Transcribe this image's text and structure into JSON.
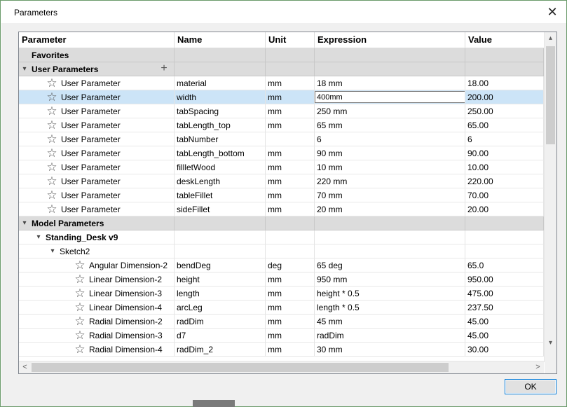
{
  "window": {
    "title": "Parameters",
    "close_glyph": "✕"
  },
  "columns": {
    "parameter": "Parameter",
    "name": "Name",
    "unit": "Unit",
    "expression": "Expression",
    "value": "Value"
  },
  "rows": [
    {
      "type": "group",
      "indent": 0,
      "expander": "",
      "label": "Favorites",
      "name": "",
      "unit": "",
      "expression": "",
      "value": ""
    },
    {
      "type": "group",
      "indent": 0,
      "expander": "▾",
      "label": "User Parameters",
      "name": "",
      "unit": "",
      "expression": "",
      "value": "",
      "add_button": "+"
    },
    {
      "type": "param",
      "indent": 2,
      "label": "User Parameter",
      "name": "material",
      "unit": "mm",
      "expression": "18 mm",
      "value": "18.00"
    },
    {
      "type": "param",
      "indent": 2,
      "label": "User Parameter",
      "name": "width",
      "unit": "mm",
      "expression": "400mm",
      "value": "200.00",
      "selected": true,
      "editing": true
    },
    {
      "type": "param",
      "indent": 2,
      "label": "User Parameter",
      "name": "tabSpacing",
      "unit": "mm",
      "expression": "250 mm",
      "value": "250.00"
    },
    {
      "type": "param",
      "indent": 2,
      "label": "User Parameter",
      "name": "tabLength_top",
      "unit": "mm",
      "expression": "65 mm",
      "value": "65.00"
    },
    {
      "type": "param",
      "indent": 2,
      "label": "User Parameter",
      "name": "tabNumber",
      "unit": "",
      "expression": "6",
      "value": "6"
    },
    {
      "type": "param",
      "indent": 2,
      "label": "User Parameter",
      "name": "tabLength_bottom",
      "unit": "mm",
      "expression": "90 mm",
      "value": "90.00"
    },
    {
      "type": "param",
      "indent": 2,
      "label": "User Parameter",
      "name": "fillletWood",
      "unit": "mm",
      "expression": "10 mm",
      "value": "10.00"
    },
    {
      "type": "param",
      "indent": 2,
      "label": "User Parameter",
      "name": "deskLength",
      "unit": "mm",
      "expression": "220 mm",
      "value": "220.00"
    },
    {
      "type": "param",
      "indent": 2,
      "label": "User Parameter",
      "name": "tableFillet",
      "unit": "mm",
      "expression": "70 mm",
      "value": "70.00"
    },
    {
      "type": "param",
      "indent": 2,
      "label": "User Parameter",
      "name": "sideFillet",
      "unit": "mm",
      "expression": "20 mm",
      "value": "20.00"
    },
    {
      "type": "group",
      "indent": 0,
      "expander": "▾",
      "label": "Model Parameters",
      "name": "",
      "unit": "",
      "expression": "",
      "value": ""
    },
    {
      "type": "node",
      "indent": 1,
      "expander": "▾",
      "label": "Standing_Desk v9",
      "bold": true,
      "name": "",
      "unit": "",
      "expression": "",
      "value": ""
    },
    {
      "type": "node",
      "indent": 2,
      "expander": "▾",
      "label": "Sketch2",
      "bold": false,
      "name": "",
      "unit": "",
      "expression": "",
      "value": ""
    },
    {
      "type": "param",
      "indent": 4,
      "label": "Angular Dimension-2",
      "name": "bendDeg",
      "unit": "deg",
      "expression": "65 deg",
      "value": "65.0"
    },
    {
      "type": "param",
      "indent": 4,
      "label": "Linear Dimension-2",
      "name": "height",
      "unit": "mm",
      "expression": "950 mm",
      "value": "950.00"
    },
    {
      "type": "param",
      "indent": 4,
      "label": "Linear Dimension-3",
      "name": "length",
      "unit": "mm",
      "expression": "height * 0.5",
      "value": "475.00"
    },
    {
      "type": "param",
      "indent": 4,
      "label": "Linear Dimension-4",
      "name": "arcLeg",
      "unit": "mm",
      "expression": "length * 0.5",
      "value": "237.50"
    },
    {
      "type": "param",
      "indent": 4,
      "label": "Radial Dimension-2",
      "name": "radDim",
      "unit": "mm",
      "expression": "45 mm",
      "value": "45.00"
    },
    {
      "type": "param",
      "indent": 4,
      "label": "Radial Dimension-3",
      "name": "d7",
      "unit": "mm",
      "expression": "radDim",
      "value": "45.00"
    },
    {
      "type": "param",
      "indent": 4,
      "label": "Radial Dimension-4",
      "name": "radDim_2",
      "unit": "mm",
      "expression": "30 mm",
      "value": "30.00"
    }
  ],
  "scroll": {
    "up": "▴",
    "down": "▾",
    "left": "<",
    "right": ">"
  },
  "buttons": {
    "ok": "OK"
  },
  "icons": {
    "favorite": "star-outline-icon",
    "expander": "triangle-icon",
    "add": "plus-icon",
    "close": "close-icon"
  }
}
